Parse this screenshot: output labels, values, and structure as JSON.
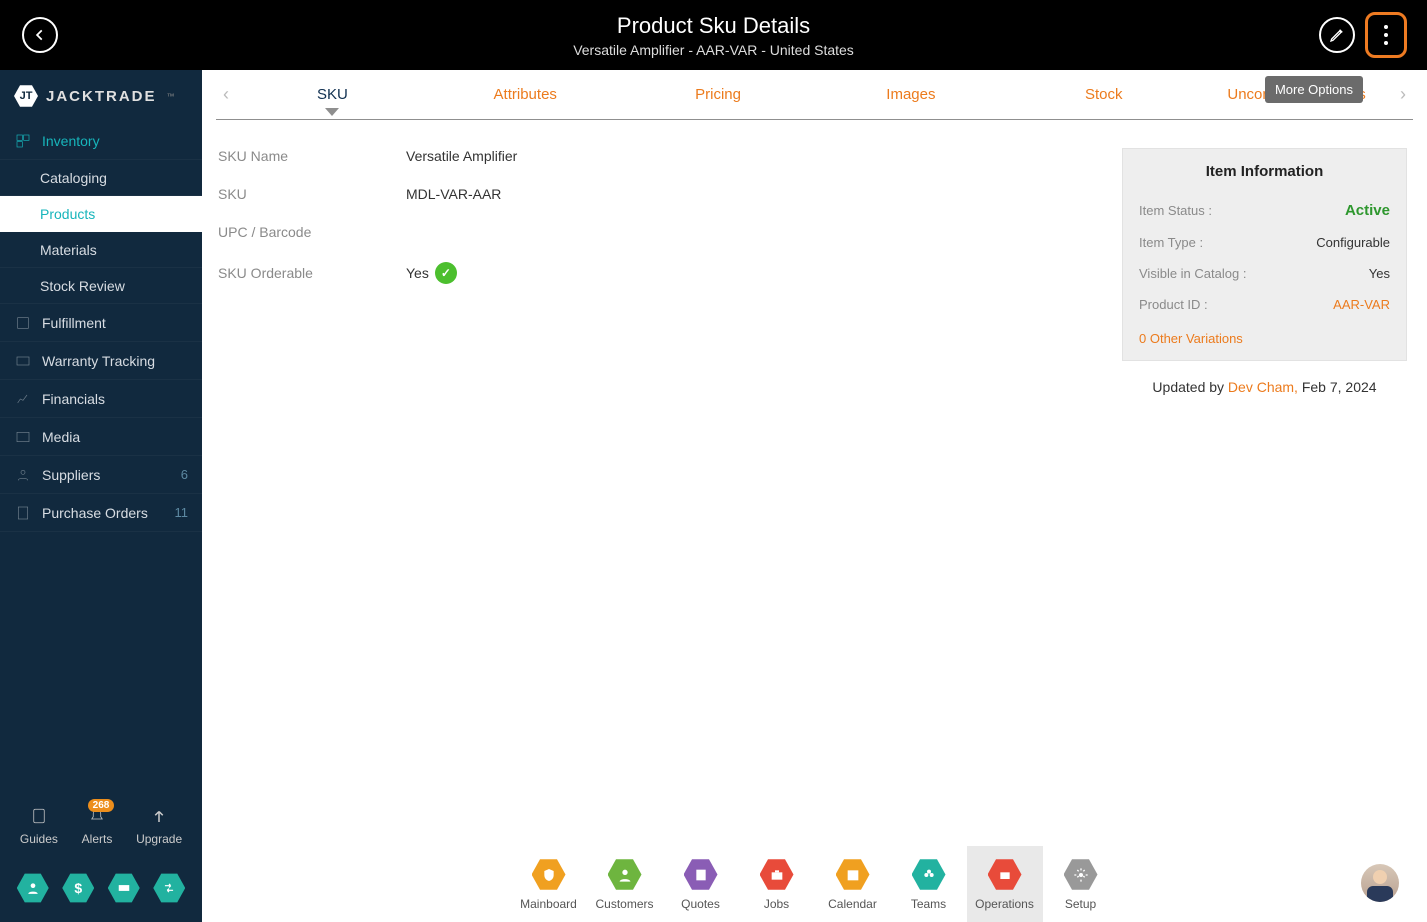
{
  "header": {
    "title": "Product Sku Details",
    "subtitle": "Versatile Amplifier - AAR-VAR - United States",
    "tooltip": "More Options"
  },
  "logo": {
    "text": "JACKTRADE",
    "tm": "™"
  },
  "sidebar": {
    "inventory": "Inventory",
    "sub": {
      "cataloging": "Cataloging",
      "products": "Products",
      "materials": "Materials",
      "stockreview": "Stock Review"
    },
    "fulfillment": "Fulfillment",
    "warranty": "Warranty Tracking",
    "financials": "Financials",
    "media": "Media",
    "suppliers": "Suppliers",
    "suppliers_count": "6",
    "purchase": "Purchase Orders",
    "purchase_count": "11",
    "buttons": {
      "guides": "Guides",
      "alerts": "Alerts",
      "alerts_badge": "268",
      "upgrade": "Upgrade"
    }
  },
  "tabs": {
    "sku": "SKU",
    "attributes": "Attributes",
    "pricing": "Pricing",
    "images": "Images",
    "stock": "Stock",
    "uncommitted": "Uncommitted Serials"
  },
  "details": {
    "sku_name_lbl": "SKU Name",
    "sku_name_val": "Versatile Amplifier",
    "sku_lbl": "SKU",
    "sku_val": "MDL-VAR-AAR",
    "upc_lbl": "UPC / Barcode",
    "upc_val": "",
    "orderable_lbl": "SKU Orderable",
    "orderable_val": "Yes"
  },
  "info": {
    "title": "Item Information",
    "status_lbl": "Item Status :",
    "status_val": "Active",
    "type_lbl": "Item Type :",
    "type_val": "Configurable",
    "visible_lbl": "Visible in Catalog :",
    "visible_val": "Yes",
    "productid_lbl": "Product ID :",
    "productid_val": "AAR-VAR",
    "variations": "0 Other Variations",
    "updated_prefix": "Updated by ",
    "updated_who": "Dev Cham,",
    "updated_date": " Feb 7, 2024"
  },
  "bottom": {
    "mainboard": "Mainboard",
    "customers": "Customers",
    "quotes": "Quotes",
    "jobs": "Jobs",
    "calendar": "Calendar",
    "teams": "Teams",
    "operations": "Operations",
    "setup": "Setup"
  }
}
